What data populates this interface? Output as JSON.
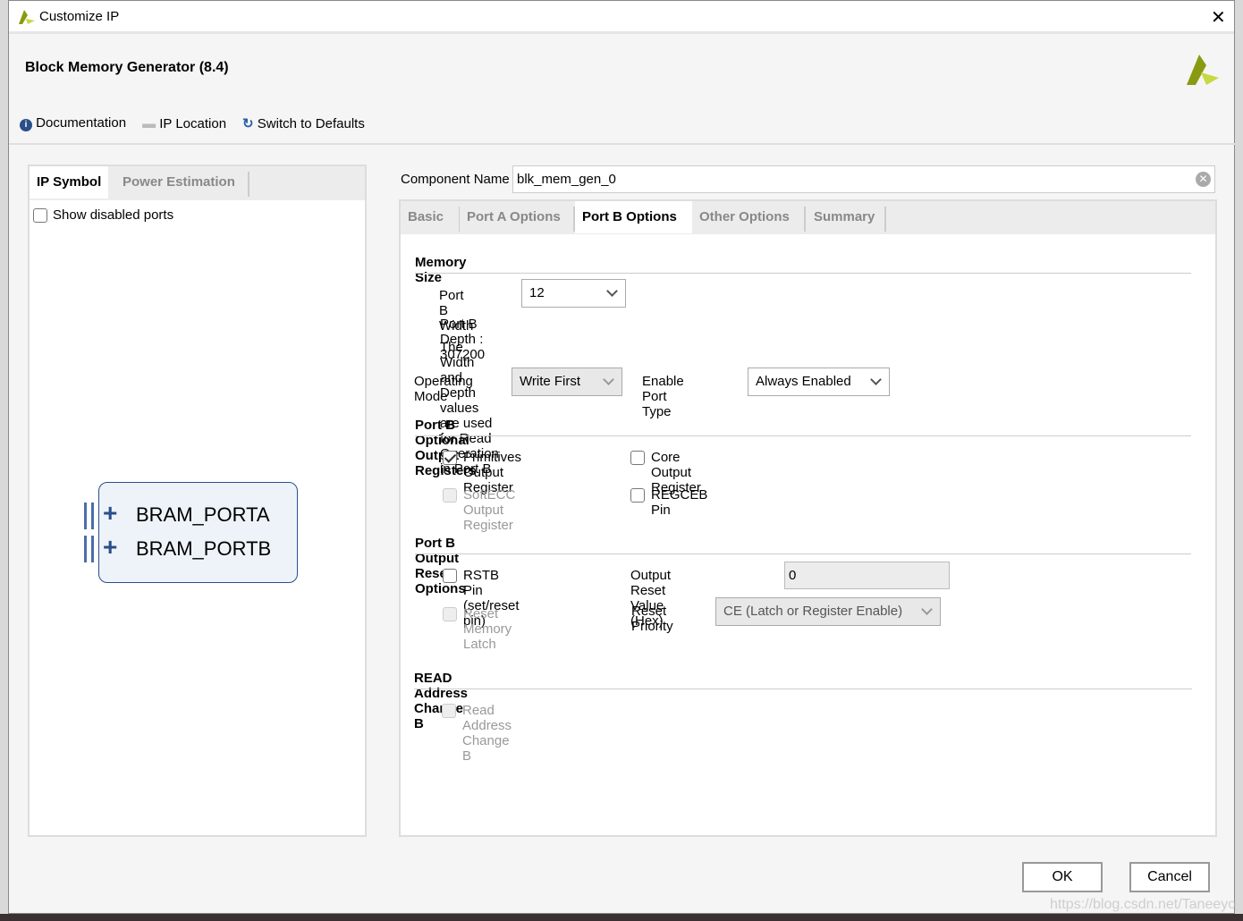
{
  "window": {
    "title": "Customize IP"
  },
  "header": {
    "title": "Block Memory Generator (8.4)"
  },
  "toolbar": {
    "documentation": "Documentation",
    "ip_location": "IP Location",
    "switch_defaults": "Switch to Defaults"
  },
  "left": {
    "tabs": [
      "IP Symbol",
      "Power Estimation"
    ],
    "show_disabled": "Show disabled ports",
    "ports": [
      "BRAM_PORTA",
      "BRAM_PORTB"
    ]
  },
  "component": {
    "label": "Component Name",
    "value": "blk_mem_gen_0"
  },
  "tabs": [
    "Basic",
    "Port A Options",
    "Port B Options",
    "Other Options",
    "Summary"
  ],
  "memory": {
    "title": "Memory Size",
    "width_label": "Port B Width",
    "width_value": "12",
    "depth": "Port B Depth : 307200",
    "note": "The Width and Depth values are used for Read Operation in Port B",
    "op_label": "Operating Mode",
    "op_value": "Write First",
    "enable_label": "Enable Port Type",
    "enable_value": "Always Enabled"
  },
  "optreg": {
    "title": "Port B Optional Output Registers",
    "prim": "Primitives Output Register",
    "core": "Core Output Register",
    "softecc": "SoftECC Output Register",
    "regceb": "REGCEB Pin"
  },
  "reset": {
    "title": "Port B Output Reset Options",
    "rstb": "RSTB Pin (set/reset pin)",
    "value_label": "Output Reset Value (Hex)",
    "value": "0",
    "latch": "Reset Memory Latch",
    "priority_label": "Reset Priority",
    "priority_value": "CE (Latch or Register Enable)"
  },
  "readaddr": {
    "title": "READ Address Change B",
    "option": "Read Address Change B"
  },
  "buttons": {
    "ok": "OK",
    "cancel": "Cancel"
  },
  "watermark": "https://blog.csdn.net/Taneeyo",
  "colors": {
    "accent": "#2a5ea8",
    "logo": "#a8b820"
  }
}
